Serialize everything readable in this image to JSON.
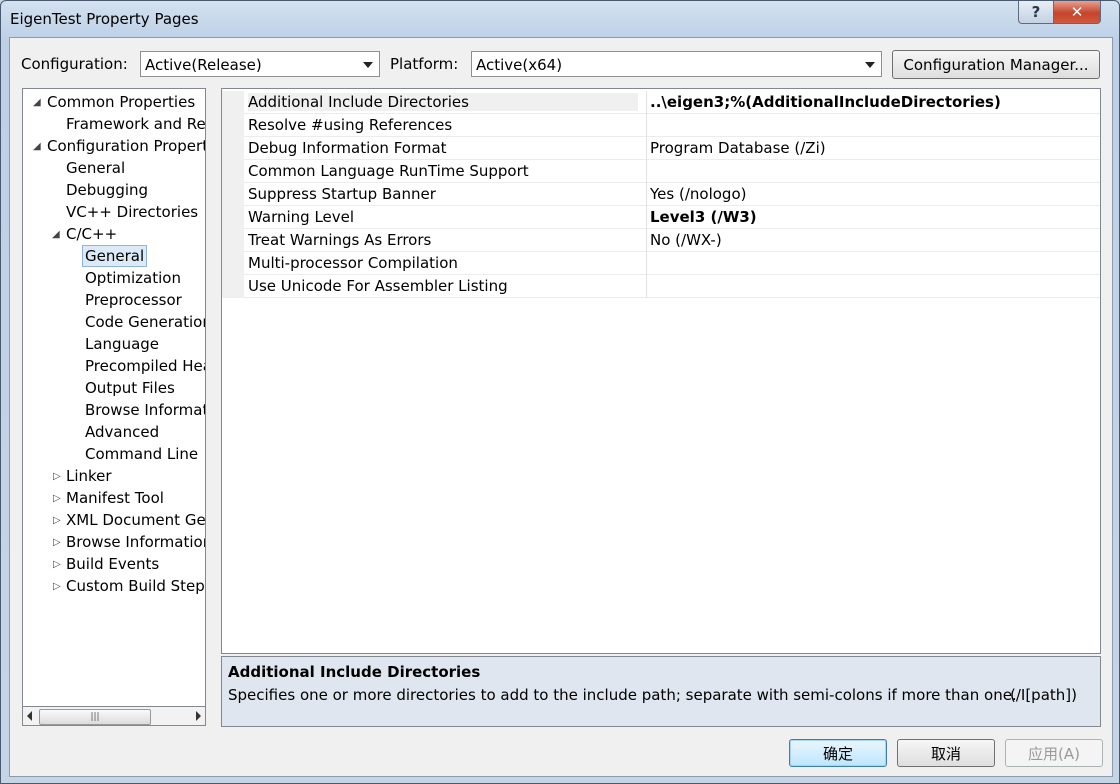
{
  "window": {
    "title": "EigenTest Property Pages",
    "help_label": "?",
    "close_label": "✕"
  },
  "toolbar": {
    "config_label": "Configuration:",
    "config_value": "Active(Release)",
    "platform_label": "Platform:",
    "platform_value": "Active(x64)",
    "config_manager_label": "Configuration Manager..."
  },
  "tree": {
    "items": [
      {
        "label": "Common Properties"
      },
      {
        "label": "Framework and Ref"
      },
      {
        "label": "Configuration Propert"
      },
      {
        "label": "General"
      },
      {
        "label": "Debugging"
      },
      {
        "label": "VC++ Directories"
      },
      {
        "label": "C/C++"
      },
      {
        "label": "General"
      },
      {
        "label": "Optimization"
      },
      {
        "label": "Preprocessor"
      },
      {
        "label": "Code Generation"
      },
      {
        "label": "Language"
      },
      {
        "label": "Precompiled Hea"
      },
      {
        "label": "Output Files"
      },
      {
        "label": "Browse Informat"
      },
      {
        "label": "Advanced"
      },
      {
        "label": "Command Line"
      },
      {
        "label": "Linker"
      },
      {
        "label": "Manifest Tool"
      },
      {
        "label": "XML Document Ger"
      },
      {
        "label": "Browse Informatior"
      },
      {
        "label": "Build Events"
      },
      {
        "label": "Custom Build Step"
      }
    ],
    "expanded_glyph": "◢",
    "collapsed_glyph": "▷",
    "scroll_thumb_glyph": "|||"
  },
  "grid": {
    "rows": [
      {
        "name": "Additional Include Directories",
        "value": "..\\eigen3;%(AdditionalIncludeDirectories)"
      },
      {
        "name": "Resolve #using References",
        "value": ""
      },
      {
        "name": "Debug Information Format",
        "value": "Program Database (/Zi)"
      },
      {
        "name": "Common Language RunTime Support",
        "value": ""
      },
      {
        "name": "Suppress Startup Banner",
        "value": "Yes (/nologo)"
      },
      {
        "name": "Warning Level",
        "value": "Level3 (/W3)"
      },
      {
        "name": "Treat Warnings As Errors",
        "value": "No (/WX-)"
      },
      {
        "name": "Multi-processor Compilation",
        "value": ""
      },
      {
        "name": "Use Unicode For Assembler Listing",
        "value": ""
      }
    ]
  },
  "description": {
    "title": "Additional Include Directories",
    "body": "Specifies one or more directories to add to the include path; separate with semi-colons if more than one.",
    "switch": "(/I[path])"
  },
  "buttons": {
    "ok": "确定",
    "cancel": "取消",
    "apply": "应用(A)"
  }
}
